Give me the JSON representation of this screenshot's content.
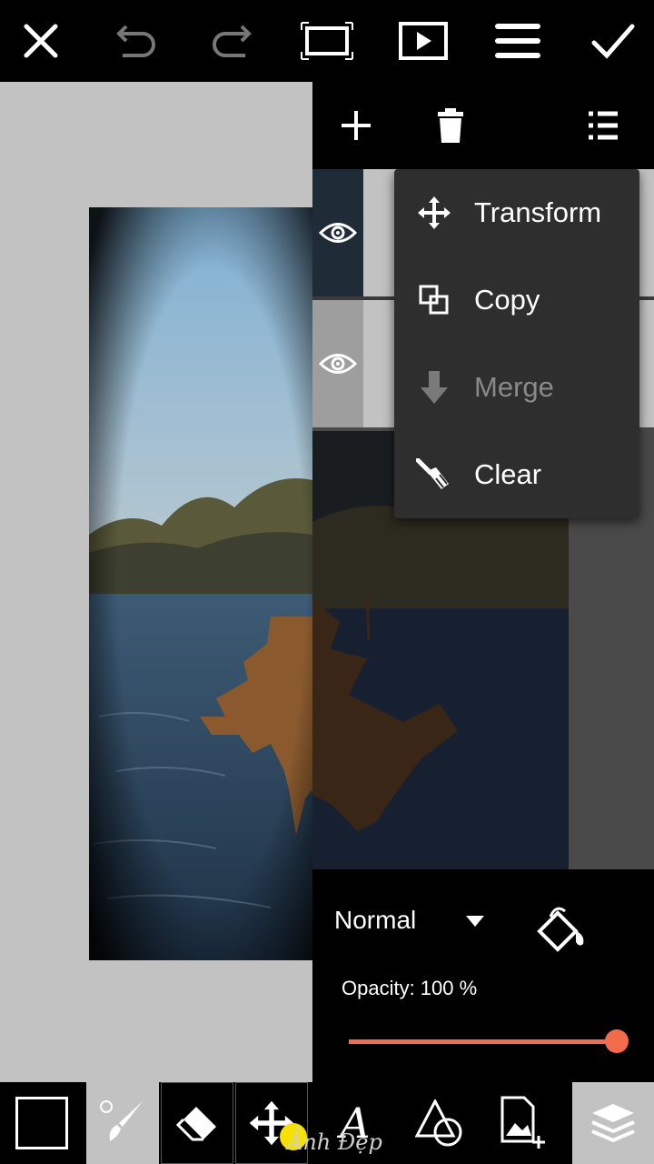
{
  "top_toolbar": {
    "icons": [
      "close-icon",
      "undo-icon",
      "redo-icon",
      "crop-frame-icon",
      "play-icon",
      "menu-icon",
      "check-icon"
    ]
  },
  "layers_toolbar": {
    "icons": [
      "add-icon",
      "trash-icon",
      "list-icon"
    ]
  },
  "context_menu": {
    "items": [
      {
        "label": "Transform",
        "icon": "move-arrows-icon",
        "enabled": true
      },
      {
        "label": "Copy",
        "icon": "copy-icon",
        "enabled": true
      },
      {
        "label": "Merge",
        "icon": "merge-down-arrow-icon",
        "enabled": false
      },
      {
        "label": "Clear",
        "icon": "broom-icon",
        "enabled": true
      }
    ]
  },
  "layer_properties": {
    "blend_mode": "Normal",
    "opacity_label": "Opacity: 100 %",
    "opacity_value": 1.0
  },
  "bottom_toolbar": {
    "tools": [
      "color-swatch",
      "brush-icon",
      "eraser-icon",
      "move-icon",
      "text-icon",
      "shapes-icon",
      "add-image-icon",
      "layers-icon"
    ],
    "watermark_text": "Ảnh Đẹp"
  },
  "colors": {
    "accent": "#f26b4b",
    "menu_bg": "#2e2e2e",
    "toolbar_bg": "#000000",
    "selected_tool_bg": "#c2c2c2"
  }
}
